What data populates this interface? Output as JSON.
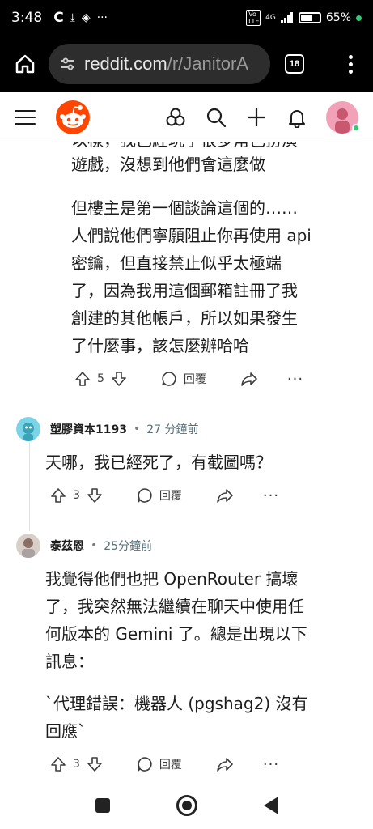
{
  "status_bar": {
    "time": "3:48",
    "notif_icons": [
      "c-icon",
      "download-icon",
      "shield-icon",
      "more-dots-icon"
    ],
    "network": "4G",
    "volte": "Vo LTE",
    "battery": "65%"
  },
  "browser": {
    "url_host": "reddit.com",
    "url_path": "/r/JanitorA",
    "tab_count": "18"
  },
  "comments": {
    "top_cut_line": "以樣，我已經玩了很多角色扮演",
    "first": {
      "line_top": "遊戲，沒想到他們會這麼做",
      "para2": [
        "但樓主是第一個談論這個的……",
        "人們說他們寧願阻止你再使用 api",
        "密鑰，但直接禁止似乎太極端",
        "了，因為我用這個郵箱註冊了我",
        "創建的其他帳戶，所以如果發生",
        "了什麼事，該怎麼辦哈哈"
      ],
      "votes": "5",
      "reply_label": "回覆"
    },
    "second": {
      "username": "塑膠資本1193",
      "time": "27 分鐘前",
      "text": "天哪，我已經死了，有截圖嗎？",
      "votes": "3",
      "reply_label": "回覆"
    },
    "third": {
      "username": "泰茲恩",
      "time": "25分鐘前",
      "para1": [
        "我覺得他們也把 OpenRouter 搞壞",
        "了，我突然無法繼續在聊天中使用任",
        "何版本的 Gemini 了。總是出現以下",
        "訊息："
      ],
      "para2": [
        "`代理錯誤：機器人 (pgshag2) 沒有",
        "回應`"
      ],
      "votes": "3",
      "reply_label": "回覆"
    }
  },
  "colors": {
    "reddit_orange": "#ff4500",
    "online": "#2ecc71"
  }
}
